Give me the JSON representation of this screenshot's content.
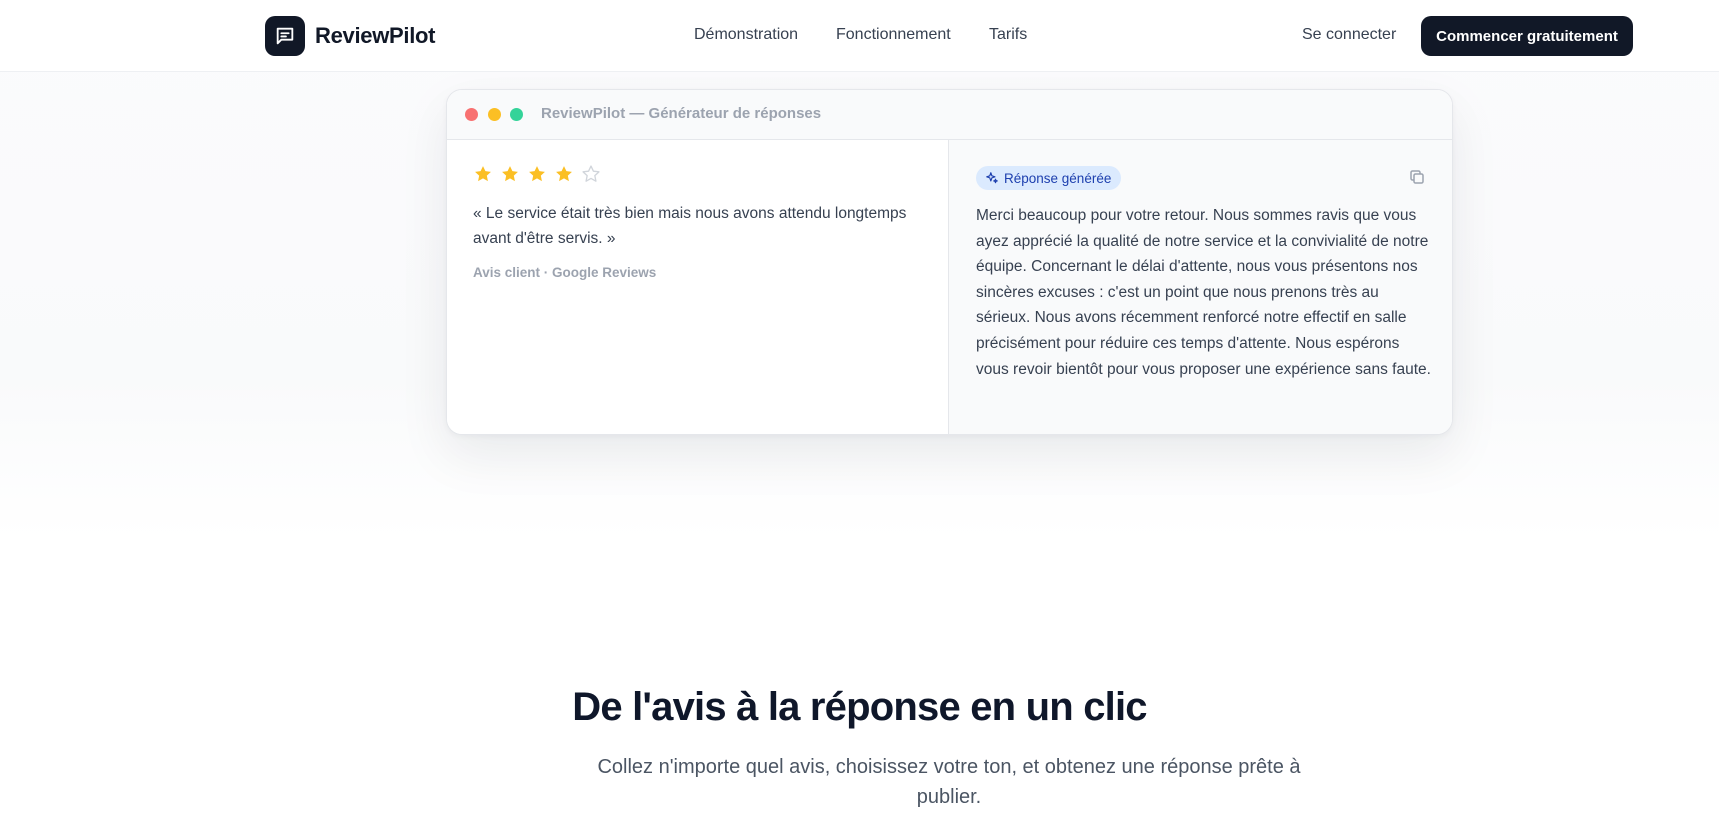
{
  "nav": {
    "brand": "ReviewPilot",
    "links": [
      "Démonstration",
      "Fonctionnement",
      "Tarifs"
    ],
    "login": "Se connecter",
    "cta": "Commencer gratuitement"
  },
  "demo": {
    "window_title": "ReviewPilot — Générateur de réponses",
    "rating": 4,
    "max_rating": 5,
    "review_text": "« Le service était très bien mais nous avons attendu longtemps avant d'être servis. »",
    "review_source": "Avis client · Google Reviews",
    "badge": "Réponse générée",
    "response_text": "Merci beaucoup pour votre retour. Nous sommes ravis que vous ayez apprécié la qualité de notre service et la convivialité de notre équipe. Concernant le délai d'attente, nous vous présentons nos sincères excuses : c'est un point que nous prenons très au sérieux. Nous avons récemment renforcé notre effectif en salle précisément pour réduire ces temps d'attente. Nous espérons vous revoir bientôt pour vous proposer une expérience sans faute."
  },
  "section": {
    "title": "De l'avis à la réponse en un clic",
    "subtitle": "Collez n'importe quel avis, choisissez votre ton, et obtenez une réponse prête à publier."
  },
  "colors": {
    "brand_dark": "#111827",
    "star_filled": "#fbbf24",
    "star_empty": "#d1d5db",
    "badge_bg": "#dbeafe",
    "badge_text": "#1e40af"
  },
  "icons": {
    "logo": "chat-bubble-icon",
    "badge": "sparkles-icon",
    "copy": "copy-icon",
    "star": "star-icon"
  }
}
